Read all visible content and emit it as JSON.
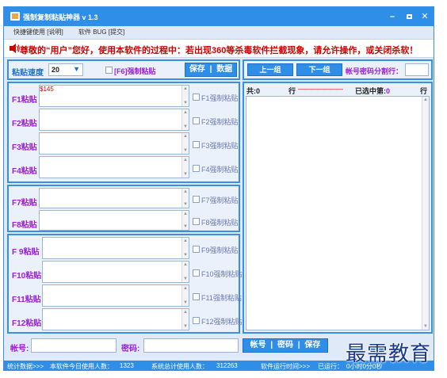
{
  "window": {
    "title": "强制复制粘贴神器 v 1.3"
  },
  "menu": {
    "item1": "快捷键使用 [说明]",
    "item2": "软件 BUG [提交]"
  },
  "notice": "尊敬的“用户”您好，使用本软件的过程中：若出现360等杀毒软件拦截现象，请允许操作，或关闭杀软！",
  "toolbar": {
    "speed_label": "粘贴速度",
    "speed_value": "20",
    "f6_label": "[F6]强制粘贴",
    "save_label": "保存",
    "data_label": "数据",
    "prev_label": "上一组",
    "next_label": "下一组",
    "separator_label": "帐号密码分割行："
  },
  "slots": [
    {
      "label": "F1粘贴",
      "value": "$145",
      "check": "F1强制粘贴"
    },
    {
      "label": "F2粘贴",
      "value": "",
      "check": "F2强制粘贴"
    },
    {
      "label": "F3粘贴",
      "value": "",
      "check": "F3强制粘贴"
    },
    {
      "label": "F4粘贴",
      "value": "",
      "check": "F4强制粘贴"
    },
    {
      "label": "F7粘贴",
      "value": "",
      "check": "F7强制粘贴"
    },
    {
      "label": "F8粘贴",
      "value": "",
      "check": "F8强制粘贴"
    },
    {
      "label": "F 9粘贴",
      "value": "",
      "check": "F9强制粘贴"
    },
    {
      "label": "F10粘贴",
      "value": "",
      "check": "F10强制粘贴"
    },
    {
      "label": "F11粘贴",
      "value": "",
      "check": "F11强制粘贴"
    },
    {
      "label": "F12粘贴",
      "value": "",
      "check": "F12强制粘贴"
    }
  ],
  "right": {
    "total_prefix": "共:",
    "total_value": "0",
    "row_word": "行",
    "dashes": "———————",
    "selected_prefix": "已选中第:",
    "selected_value": "0",
    "row_word2": "行"
  },
  "bottom": {
    "account_label": "帐号:",
    "password_label": "密码:",
    "btn_account": "帐号",
    "btn_password": "密码",
    "btn_save": "保存"
  },
  "status": {
    "s1": "统计数据>>>",
    "s2": "本软件今日使用人数：",
    "s3": "1323",
    "s4": "系统总计使用人数：",
    "s5": "312263",
    "s6": "软件运行时间>>>",
    "s7": "已运行：",
    "s8": "0小时0分0秒"
  },
  "watermark": "最需教育",
  "colors": {
    "accent": "#2e8ee8",
    "warning": "#d00000",
    "label": "#9a1fd6"
  }
}
